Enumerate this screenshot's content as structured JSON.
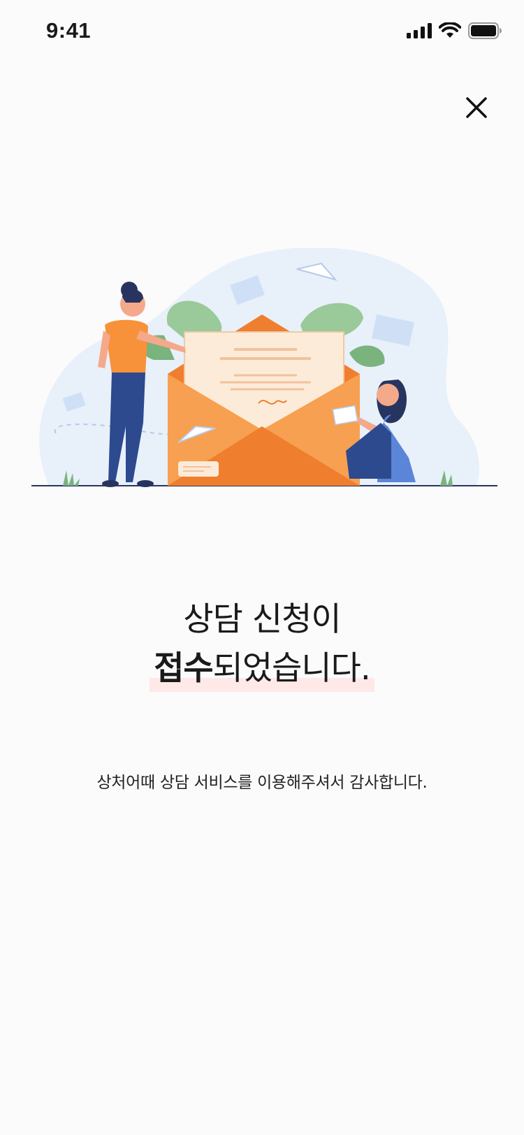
{
  "status_bar": {
    "time": "9:41",
    "icons": [
      "signal-icon",
      "wifi-icon",
      "battery-icon"
    ]
  },
  "close_button": {
    "icon": "close-icon"
  },
  "message": {
    "title_line1": "상담 신청이",
    "title_line2_strong": "접수",
    "title_line2_rest": "되었습니다.",
    "subtitle": "상처어때 상담 서비스를 이용해주셔서 감사합니다."
  },
  "colors": {
    "background": "#fbfbfb",
    "highlight": "#ffe8e8",
    "envelope_orange": "#f5923e",
    "accent_blue": "#2d4a8f"
  }
}
